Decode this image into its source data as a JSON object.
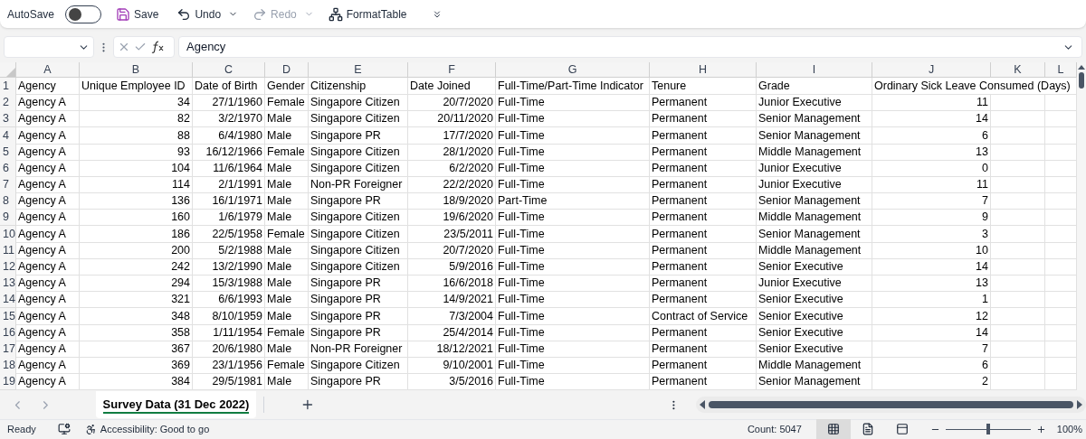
{
  "toolbar": {
    "autosave": {
      "label": "AutoSave",
      "on": false
    },
    "buttons": [
      {
        "kind": "save",
        "label": "Save",
        "disabled": false
      },
      {
        "kind": "undo",
        "label": "Undo",
        "disabled": false
      },
      {
        "kind": "redo",
        "label": "Redo",
        "disabled": true
      },
      {
        "kind": "format",
        "label": "FormatTable",
        "disabled": false
      }
    ]
  },
  "formula_bar": {
    "formula": "Agency"
  },
  "columns": [
    {
      "letter": "A",
      "numeric": false
    },
    {
      "letter": "B",
      "numeric": true
    },
    {
      "letter": "C",
      "numeric": true
    },
    {
      "letter": "D",
      "numeric": false
    },
    {
      "letter": "E",
      "numeric": false
    },
    {
      "letter": "F",
      "numeric": true
    },
    {
      "letter": "G",
      "numeric": false
    },
    {
      "letter": "H",
      "numeric": false
    },
    {
      "letter": "I",
      "numeric": false
    },
    {
      "letter": "J",
      "numeric": true
    },
    {
      "letter": "K"
    },
    {
      "letter": "L"
    }
  ],
  "header_row": {
    "number": "1",
    "cells": [
      "Agency",
      "Unique Employee ID",
      "Date of Birth",
      "Gender",
      "Citizenship",
      "Date Joined",
      "Full-Time/Part-Time Indicator",
      "Tenure",
      "Grade",
      "Ordinary Sick Leave Consumed (Days)"
    ]
  },
  "rows": [
    {
      "number": "2",
      "cells": [
        "Agency A",
        "34",
        "27/1/1960",
        "Female",
        "Singapore Citizen",
        "20/7/2020",
        "Full-Time",
        "Permanent",
        "Junior Executive",
        "11"
      ]
    },
    {
      "number": "3",
      "cells": [
        "Agency A",
        "82",
        "3/2/1970",
        "Male",
        "Singapore Citizen",
        "20/11/2020",
        "Full-Time",
        "Permanent",
        "Senior Management",
        "14"
      ]
    },
    {
      "number": "4",
      "cells": [
        "Agency A",
        "88",
        "6/4/1980",
        "Male",
        "Singapore PR",
        "17/7/2020",
        "Full-Time",
        "Permanent",
        "Senior Management",
        "6"
      ]
    },
    {
      "number": "5",
      "cells": [
        "Agency A",
        "93",
        "16/12/1966",
        "Female",
        "Singapore Citizen",
        "28/1/2020",
        "Full-Time",
        "Permanent",
        "Middle Management",
        "13"
      ]
    },
    {
      "number": "6",
      "cells": [
        "Agency A",
        "104",
        "11/6/1964",
        "Male",
        "Singapore Citizen",
        "6/2/2020",
        "Full-Time",
        "Permanent",
        "Junior Executive",
        "0"
      ]
    },
    {
      "number": "7",
      "cells": [
        "Agency A",
        "114",
        "2/1/1991",
        "Male",
        "Non-PR Foreigner",
        "22/2/2020",
        "Full-Time",
        "Permanent",
        "Junior Executive",
        "11"
      ]
    },
    {
      "number": "8",
      "cells": [
        "Agency A",
        "136",
        "16/1/1971",
        "Male",
        "Singapore PR",
        "18/9/2020",
        "Part-Time",
        "Permanent",
        "Senior Management",
        "7"
      ]
    },
    {
      "number": "9",
      "cells": [
        "Agency A",
        "160",
        "1/6/1979",
        "Male",
        "Singapore Citizen",
        "19/6/2020",
        "Full-Time",
        "Permanent",
        "Middle Management",
        "9"
      ]
    },
    {
      "number": "10",
      "cells": [
        "Agency A",
        "186",
        "22/5/1958",
        "Female",
        "Singapore Citizen",
        "23/5/2011",
        "Full-Time",
        "Permanent",
        "Senior Management",
        "3"
      ]
    },
    {
      "number": "11",
      "cells": [
        "Agency A",
        "200",
        "5/2/1988",
        "Male",
        "Singapore Citizen",
        "20/7/2020",
        "Full-Time",
        "Permanent",
        "Middle Management",
        "10"
      ]
    },
    {
      "number": "12",
      "cells": [
        "Agency A",
        "242",
        "13/2/1990",
        "Male",
        "Singapore Citizen",
        "5/9/2016",
        "Full-Time",
        "Permanent",
        "Senior Executive",
        "14"
      ]
    },
    {
      "number": "13",
      "cells": [
        "Agency A",
        "294",
        "15/3/1988",
        "Male",
        "Singapore PR",
        "16/6/2018",
        "Full-Time",
        "Permanent",
        "Junior Executive",
        "13"
      ]
    },
    {
      "number": "14",
      "cells": [
        "Agency A",
        "321",
        "6/6/1993",
        "Male",
        "Singapore PR",
        "14/9/2021",
        "Full-Time",
        "Permanent",
        "Senior Executive",
        "1"
      ]
    },
    {
      "number": "15",
      "cells": [
        "Agency A",
        "348",
        "8/10/1959",
        "Male",
        "Singapore PR",
        "7/3/2004",
        "Full-Time",
        "Contract of Service",
        "Senior Executive",
        "12"
      ]
    },
    {
      "number": "16",
      "cells": [
        "Agency A",
        "358",
        "1/11/1954",
        "Female",
        "Singapore PR",
        "25/4/2014",
        "Full-Time",
        "Permanent",
        "Senior Executive",
        "14"
      ]
    },
    {
      "number": "17",
      "cells": [
        "Agency A",
        "367",
        "20/6/1980",
        "Male",
        "Non-PR Foreigner",
        "18/12/2021",
        "Full-Time",
        "Permanent",
        "Senior Executive",
        "7"
      ]
    },
    {
      "number": "18",
      "cells": [
        "Agency A",
        "369",
        "23/1/1956",
        "Female",
        "Singapore Citizen",
        "9/10/2001",
        "Full-Time",
        "Permanent",
        "Middle Management",
        "6"
      ]
    },
    {
      "number": "19",
      "cells": [
        "Agency A",
        "384",
        "29/5/1981",
        "Male",
        "Singapore PR",
        "3/5/2016",
        "Full-Time",
        "Permanent",
        "Senior Management",
        "2"
      ]
    }
  ],
  "sheet_tabs": [
    {
      "label": "Survey Data (31 Dec 2022)",
      "selected": true
    }
  ],
  "status_bar": {
    "ready": "Ready",
    "accessibility": "Accessibility: Good to go",
    "count": "Count: 5047",
    "views": [
      {
        "kind": "normal",
        "selected": true
      },
      {
        "kind": "page-layout",
        "selected": false
      },
      {
        "kind": "page-break",
        "selected": false
      }
    ],
    "zoom": {
      "level": 0.5,
      "reading": "100%"
    }
  }
}
